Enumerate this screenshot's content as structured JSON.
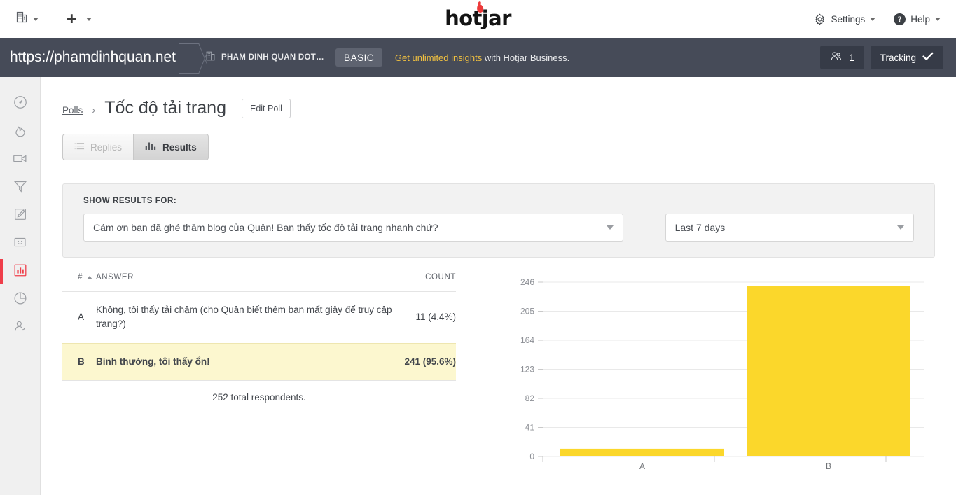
{
  "topbar": {
    "org_switcher_icon": "building-icon",
    "add_icon": "plus-icon",
    "logo_text": "hotjar",
    "settings_label": "Settings",
    "settings_icon": "gear-icon",
    "help_label": "Help",
    "help_icon": "question-circle-icon"
  },
  "sitebar": {
    "site_url": "https://phamdinhquan.net",
    "org_icon": "building-icon",
    "org_name": "PHAM DINH QUAN DOT…",
    "plan_badge": "BASIC",
    "upsell_link": "Get unlimited insights",
    "upsell_rest": " with Hotjar Business.",
    "users_icon": "users-icon",
    "users_count": "1",
    "tracking_label": "Tracking",
    "tracking_icon": "check-icon",
    "bar_color": "#464b58",
    "accent_yellow": "#f0c040"
  },
  "sidebar": {
    "collapse_icon": "chevron-right-icon",
    "active_color": "#ef3e4a",
    "items": [
      {
        "name": "dashboard",
        "icon": "gauge-icon",
        "active": false
      },
      {
        "name": "heatmaps",
        "icon": "flame-icon",
        "active": false
      },
      {
        "name": "recordings",
        "icon": "video-camera-icon",
        "active": false
      },
      {
        "name": "funnels",
        "icon": "funnel-icon",
        "active": false
      },
      {
        "name": "forms",
        "icon": "pencil-square-icon",
        "active": false
      },
      {
        "name": "feedback",
        "icon": "smiley-box-icon",
        "active": false
      },
      {
        "name": "polls",
        "icon": "bar-chart-icon",
        "active": true
      },
      {
        "name": "surveys",
        "icon": "pie-chart-icon",
        "active": false
      },
      {
        "name": "recruiters",
        "icon": "person-check-icon",
        "active": false
      }
    ]
  },
  "breadcrumb": {
    "parent": "Polls",
    "separator": "›",
    "title": "Tốc độ tải trang",
    "edit_button": "Edit Poll"
  },
  "tabs": [
    {
      "label": "Replies",
      "icon": "list-icon",
      "state": "disabled"
    },
    {
      "label": "Results",
      "icon": "bar-chart-icon",
      "state": "active"
    }
  ],
  "filters": {
    "label": "SHOW RESULTS FOR:",
    "question_value": "Cám ơn bạn đã ghé thăm blog của Quân! Bạn thấy tốc độ tải trang nhanh chứ?",
    "daterange_value": "Last 7 days"
  },
  "table": {
    "headers": {
      "num": "#",
      "answer": "ANSWER",
      "count": "COUNT"
    },
    "rows": [
      {
        "key": "A",
        "answer": "Không, tôi thấy tải chậm (cho Quân biết thêm bạn mất giây để truy cập trang?)",
        "count": "11 (4.4%)",
        "highlight": false
      },
      {
        "key": "B",
        "answer": "Bình thường, tôi thấy ổn!",
        "count": "241 (95.6%)",
        "highlight": true
      }
    ],
    "total_text": "252 total respondents."
  },
  "chart_data": {
    "type": "bar",
    "categories": [
      "A",
      "B"
    ],
    "values": [
      11,
      241
    ],
    "title": "",
    "xlabel": "",
    "ylabel": "",
    "ylim": [
      0,
      246
    ],
    "yticks": [
      0,
      41,
      82,
      123,
      164,
      205,
      246
    ],
    "ytick_labels": [
      "0",
      "41",
      "82",
      "123",
      "164",
      "205",
      "246"
    ],
    "grid": true,
    "legend": false,
    "bar_color": "#fbd72b",
    "series": [
      {
        "name": "Count",
        "values": [
          11,
          241
        ]
      }
    ]
  }
}
